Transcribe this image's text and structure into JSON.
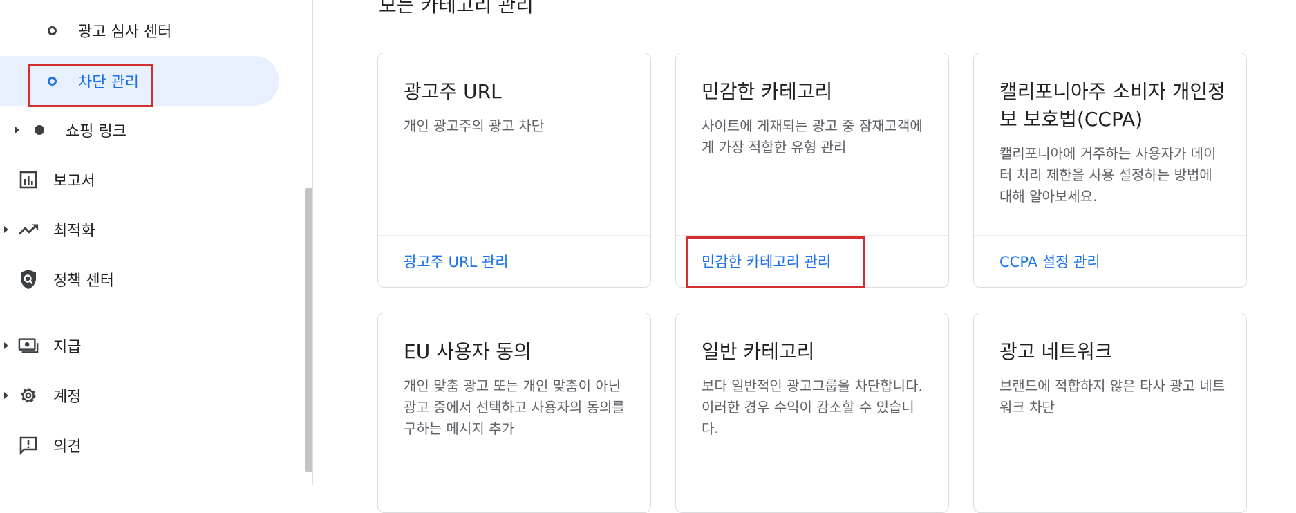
{
  "sidebar": {
    "items": [
      {
        "label": "광고 심사 센터",
        "type": "sub"
      },
      {
        "label": "차단 관리",
        "type": "sub-active"
      },
      {
        "label": "쇼핑 링크",
        "type": "expandable-dot"
      },
      {
        "label": "보고서",
        "icon": "bar-chart-icon"
      },
      {
        "label": "최적화",
        "icon": "trending-up-icon"
      },
      {
        "label": "정책 센터",
        "icon": "policy-shield-icon"
      },
      {
        "label": "지급",
        "icon": "payments-icon"
      },
      {
        "label": "계정",
        "icon": "gear-icon"
      },
      {
        "label": "의견",
        "icon": "feedback-icon"
      }
    ]
  },
  "main": {
    "section_title_partial": "모든 카테고리 관리",
    "cards": [
      {
        "title": "광고주 URL",
        "description": "개인 광고주의 광고 차단",
        "link": "광고주 URL 관리"
      },
      {
        "title": "민감한 카테고리",
        "description": "사이트에 게재되는 광고 중 잠재고객에게 가장 적합한 유형 관리",
        "link": "민감한 카테고리 관리"
      },
      {
        "title": "캘리포니아주 소비자 개인정보 보호법(CCPA)",
        "description": "캘리포니아에 거주하는 사용자가 데이터 처리 제한을 사용 설정하는 방법에 대해 알아보세요.",
        "link": "CCPA 설정 관리"
      },
      {
        "title": "EU 사용자 동의",
        "description": "개인 맞춤 광고 또는 개인 맞춤이 아닌 광고 중에서 선택하고 사용자의 동의를 구하는 메시지 추가"
      },
      {
        "title": "일반 카테고리",
        "description": "보다 일반적인 광고그룹을 차단합니다. 이러한 경우 수익이 감소할 수 있습니다."
      },
      {
        "title": "광고 네트워크",
        "description": "브랜드에 적합하지 않은 타사 광고 네트워크 차단"
      }
    ]
  },
  "colors": {
    "accent": "#1a73e8",
    "highlight": "#d32f2f",
    "active_bg": "#e8f0fe"
  }
}
